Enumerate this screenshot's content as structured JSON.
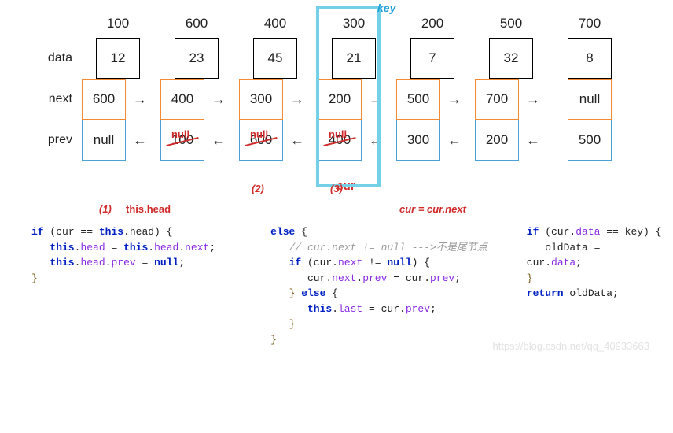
{
  "labels": {
    "data": "data",
    "next": "next",
    "prev": "prev",
    "key_label": "key",
    "cur_label": "cur",
    "this_head": "this.head",
    "cur_next": "cur = cur.next",
    "step1": "(1)",
    "step2": "(2)",
    "step3": "(3)",
    "null_ann": "null",
    "watermark": "https://blog.csdn.net/qq_40933663"
  },
  "arrows": {
    "right": "→",
    "left": "←"
  },
  "nodes": [
    {
      "addr": "100",
      "data": "12",
      "next": "600",
      "prev": "null"
    },
    {
      "addr": "600",
      "data": "23",
      "next": "400",
      "prev": "100"
    },
    {
      "addr": "400",
      "data": "45",
      "next": "300",
      "prev": "600"
    },
    {
      "addr": "300",
      "data": "21",
      "next": "200",
      "prev": "400"
    },
    {
      "addr": "200",
      "data": "7",
      "next": "500",
      "prev": "300"
    },
    {
      "addr": "500",
      "data": "32",
      "next": "700",
      "prev": "200"
    },
    {
      "addr": "700",
      "data": "8",
      "next": "null",
      "prev": "500"
    }
  ],
  "code": {
    "c1_l1": "if (cur == this.head) {",
    "c1_l2": "   this.head = this.head.next;",
    "c1_l3": "   this.head.prev = null;",
    "c1_l4": "}",
    "c2_l1": "else {",
    "c2_l2": "   // cur.next != null --->不是尾节点",
    "c2_l3": "   if (cur.next != null) {",
    "c2_l4": "      cur.next.prev = cur.prev;",
    "c2_l5": "   } else {",
    "c2_l6": "      this.last = cur.prev;",
    "c2_l7": "   }",
    "c2_l8": "}",
    "c3_l1": "if (cur.data == key) {",
    "c3_l2": "   oldData =",
    "c3_l3": "cur.data;",
    "c3_l4": "}",
    "c3_l5": "return oldData;"
  }
}
